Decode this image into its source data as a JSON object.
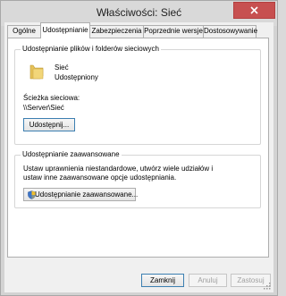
{
  "window": {
    "title": "Właściwości: Sieć",
    "close_glyph": "✕"
  },
  "tabs": [
    {
      "label": "Ogólne",
      "active": false
    },
    {
      "label": "Udostępnianie",
      "active": true
    },
    {
      "label": "Zabezpieczenia",
      "active": false
    },
    {
      "label": "Poprzednie wersje",
      "active": false
    },
    {
      "label": "Dostosowywanie",
      "active": false
    }
  ],
  "file_sharing": {
    "group_title": "Udostępnianie plików i folderów sieciowych",
    "folder_name": "Sieć",
    "folder_status": "Udostępniony",
    "path_label": "Ścieżka sieciowa:",
    "path_value": "\\\\Server\\Sieć",
    "share_button": "Udostępnij..."
  },
  "advanced_sharing": {
    "group_title": "Udostępnianie zaawansowane",
    "description_line1": "Ustaw uprawnienia niestandardowe, utwórz wiele udziałów i",
    "description_line2": "ustaw inne zaawansowane opcje udostępniania.",
    "button": "Udostępnianie zaawansowane..."
  },
  "footer": {
    "ok": "Zamknij",
    "cancel": "Anuluj",
    "apply": "Zastosuj"
  },
  "colors": {
    "close_button": "#c75050",
    "focus_border": "#3c7fb1"
  }
}
